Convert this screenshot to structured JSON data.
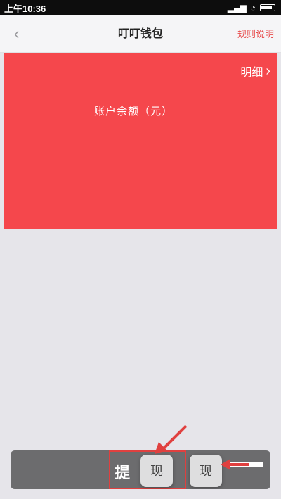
{
  "status_bar": {
    "time": "上午10:36"
  },
  "nav": {
    "title": "叮叮钱包",
    "rules_label": "规则说明"
  },
  "card": {
    "details_label": "明细",
    "balance_label": "账户余额（元）"
  },
  "bottom": {
    "withdraw_label": "提",
    "key1": "现",
    "key2": "现"
  },
  "colors": {
    "accent": "#f5474c",
    "link": "#e84a4a",
    "bottom_bar": "#6c6c6e"
  }
}
